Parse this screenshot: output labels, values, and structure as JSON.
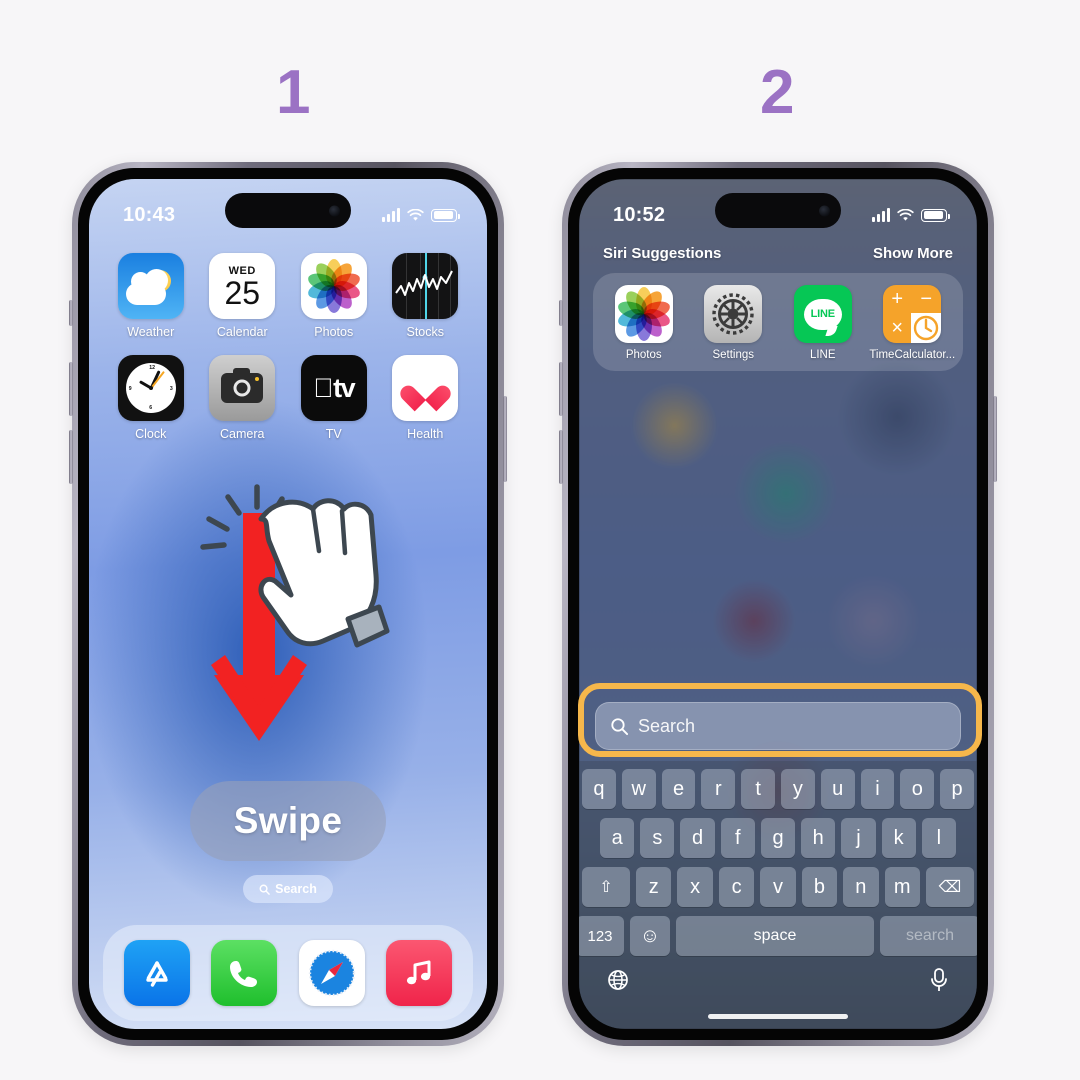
{
  "steps": [
    {
      "number": "1"
    },
    {
      "number": "2"
    }
  ],
  "colors": {
    "step_number": "#9b72c4",
    "highlight_ring": "#f6b74b",
    "arrow_red": "#f22222",
    "page_background": "#f7f6f8"
  },
  "phone1": {
    "status": {
      "time": "10:43",
      "signal": "cellular-bars",
      "wifi": "wifi-icon",
      "battery": "battery-icon"
    },
    "apps": [
      {
        "label": "Weather",
        "icon": "weather-icon"
      },
      {
        "label": "Calendar",
        "icon": "calendar-icon",
        "dow": "WED",
        "day": "25"
      },
      {
        "label": "Photos",
        "icon": "photos-icon"
      },
      {
        "label": "Stocks",
        "icon": "stocks-icon"
      },
      {
        "label": "Clock",
        "icon": "clock-icon"
      },
      {
        "label": "Camera",
        "icon": "camera-icon"
      },
      {
        "label": "TV",
        "icon": "tv-icon",
        "logo": "tv"
      },
      {
        "label": "Health",
        "icon": "health-icon"
      }
    ],
    "gesture": {
      "label": "Swipe",
      "direction": "down",
      "cursor": "hand-tap-icon"
    },
    "search_pill": {
      "label": "Search",
      "icon": "search-icon"
    },
    "dock": [
      {
        "label": "App Store",
        "icon": "appstore-icon"
      },
      {
        "label": "Phone",
        "icon": "phone-icon"
      },
      {
        "label": "Safari",
        "icon": "safari-icon"
      },
      {
        "label": "Music",
        "icon": "music-icon"
      }
    ]
  },
  "phone2": {
    "status": {
      "time": "10:52",
      "signal": "cellular-bars",
      "wifi": "wifi-icon",
      "battery": "battery-icon"
    },
    "siri": {
      "title": "Siri Suggestions",
      "show_more": "Show More",
      "apps": [
        {
          "label": "Photos",
          "icon": "photos-icon"
        },
        {
          "label": "Settings",
          "icon": "settings-icon"
        },
        {
          "label": "LINE",
          "icon": "line-icon",
          "glyph": "LINE"
        },
        {
          "label": "TimeCalculator...",
          "icon": "timecalculator-icon",
          "ops": [
            "+",
            "−",
            "×"
          ]
        }
      ]
    },
    "search": {
      "placeholder": "Search",
      "value": "",
      "icon": "search-icon",
      "highlighted": true
    },
    "keyboard": {
      "row1": [
        "q",
        "w",
        "e",
        "r",
        "t",
        "y",
        "u",
        "i",
        "o",
        "p"
      ],
      "row2": [
        "a",
        "s",
        "d",
        "f",
        "g",
        "h",
        "j",
        "k",
        "l"
      ],
      "row3": [
        "z",
        "x",
        "c",
        "v",
        "b",
        "n",
        "m"
      ],
      "shift_label": "⇧",
      "backspace_label": "⌫",
      "numbers_label": "123",
      "emoji_label": "☺",
      "space_label": "space",
      "return_label": "search",
      "globe_label": "globe-icon",
      "mic_label": "microphone-icon"
    }
  }
}
